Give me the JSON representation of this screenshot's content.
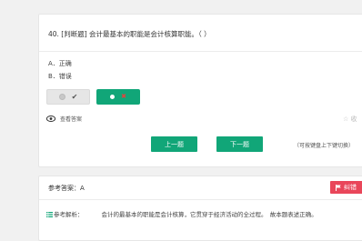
{
  "question": {
    "text": "40. [判断题] 会计最基本的职能是会计核算职能。（        ）",
    "options": [
      {
        "label": "A．正确"
      },
      {
        "label": "B．错误"
      }
    ],
    "view_answer": "查看答案",
    "favorite": "☆ 收",
    "prev_label": "上一题",
    "next_label": "下一题",
    "hint": "（可按键盘上下键切换）"
  },
  "answer": {
    "title": "参考答案：A",
    "report_label": "纠错",
    "analysis_label": "参考解析：",
    "analysis_text": "会计的最基本的职能是会计核算，它贯穿于经济活动的全过程。　故本题表述正确。"
  },
  "colors": {
    "primary": "#11a678",
    "danger": "#e9465a"
  }
}
